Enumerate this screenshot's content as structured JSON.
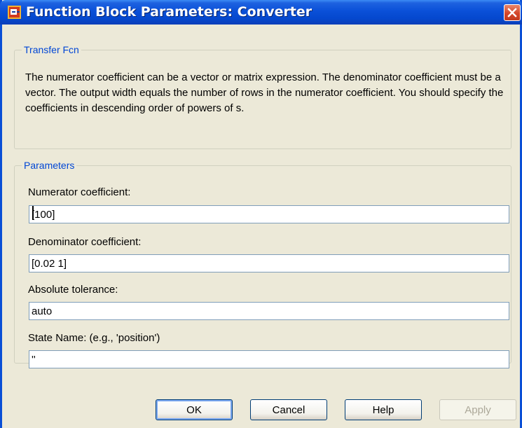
{
  "window": {
    "title": "Function Block Parameters: Converter"
  },
  "icons": {
    "app": "simulink-block-icon",
    "close": "close-icon"
  },
  "colors": {
    "titlebar": "#0A50D8",
    "group_title": "#0046D5",
    "close_button": "#D4462A",
    "dialog_bg": "#ECE9D8"
  },
  "transfer_fcn": {
    "title": "Transfer Fcn",
    "description": "The numerator coefficient can be a vector or matrix expression. The denominator coefficient must be a vector. The output width equals the number of rows in the numerator coefficient. You should specify the coefficients in descending order of powers of s."
  },
  "parameters": {
    "title": "Parameters",
    "numerator": {
      "label": "Numerator coefficient:",
      "value": "[100]"
    },
    "denominator": {
      "label": "Denominator coefficient:",
      "value": "[0.02 1]"
    },
    "tolerance": {
      "label": "Absolute tolerance:",
      "value": "auto"
    },
    "state_name": {
      "label": "State Name: (e.g., 'position')",
      "value": "''"
    }
  },
  "buttons": {
    "ok": "OK",
    "cancel": "Cancel",
    "help": "Help",
    "apply": "Apply"
  }
}
